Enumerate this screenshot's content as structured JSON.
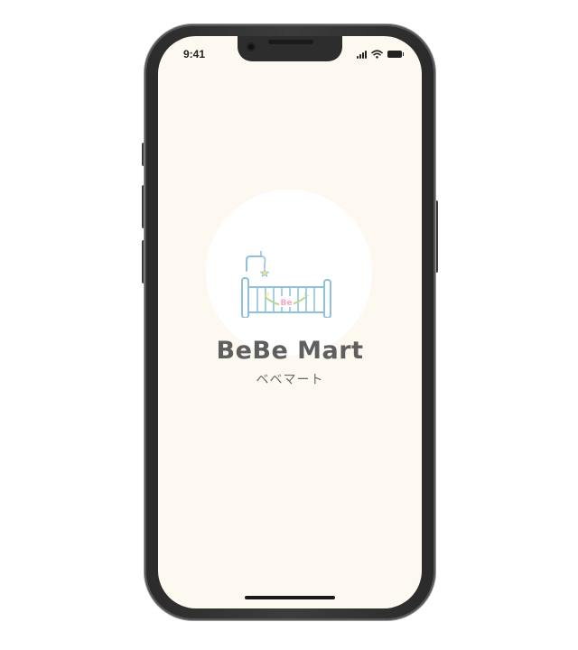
{
  "status_bar": {
    "time": "9:41",
    "icons": [
      "signal-icon",
      "wifi-icon",
      "battery-icon"
    ]
  },
  "app": {
    "brand_name": "BeBe Mart",
    "brand_kana": "ベベマート",
    "logo_badge": "Be",
    "logo_side_chars": [
      "マ",
      "ト"
    ],
    "logo_icon": "baby-crib-icon"
  },
  "colors": {
    "screen_background": "#fdf8f0",
    "logo_circle": "#ffffff",
    "crib_line": "#8fc1de",
    "crib_pastel_yellow": "#f7e27a",
    "crib_pastel_green": "#b9d98a",
    "crib_pastel_pink": "#f3a8c0",
    "brand_text": "#5f5f5f"
  }
}
